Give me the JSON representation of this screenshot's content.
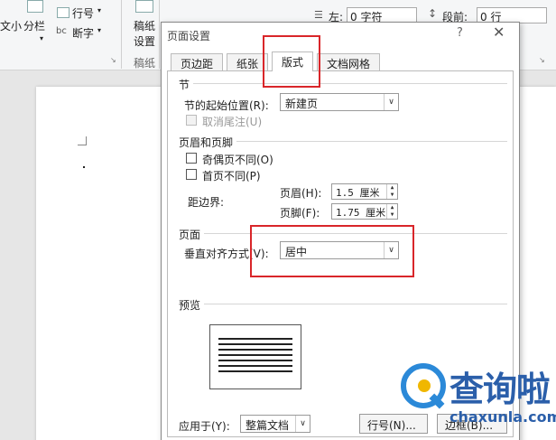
{
  "ribbon": {
    "size_label": "文小",
    "columns_label": "分栏",
    "line_number_label": "行号",
    "hyphen_label": "断字",
    "manuscript_label_1": "稿纸",
    "manuscript_label_2": "设置",
    "manuscript_group": "稿纸",
    "indent_left_label": "左:",
    "indent_left_value": "0 字符",
    "spacing_before_label": "段前:",
    "spacing_before_value": "0 行",
    "chevron": "▾"
  },
  "dialog": {
    "title": "页面设置",
    "help": "?",
    "close": "✕",
    "tabs": [
      "页边距",
      "纸张",
      "版式",
      "文档网格"
    ],
    "active_tab": "版式",
    "section_title": "节",
    "section_start_label": "节的起始位置(R):",
    "section_start_value": "新建页",
    "suppress_endnotes_label": "取消尾注(U)",
    "headers_title": "页眉和页脚",
    "odd_even_label": "奇偶页不同(O)",
    "first_page_label": "首页不同(P)",
    "from_edge_label": "距边界:",
    "header_label": "页眉(H):",
    "header_value": "1.5 厘米",
    "footer_label": "页脚(F):",
    "footer_value": "1.75 厘米",
    "page_title": "页面",
    "vertical_align_label": "垂直对齐方式(V):",
    "vertical_align_value": "居中",
    "preview_title": "预览",
    "apply_to_label": "应用于(Y):",
    "apply_to_value": "整篇文档",
    "line_numbers_button": "行号(N)...",
    "borders_button": "边框(B)..."
  },
  "watermark": {
    "text": "查询啦",
    "url": "chaxunla.com"
  },
  "colors": {
    "highlight": "#d9262a",
    "brand_blue": "#2b89d8",
    "brand_text": "#2b5faa"
  }
}
